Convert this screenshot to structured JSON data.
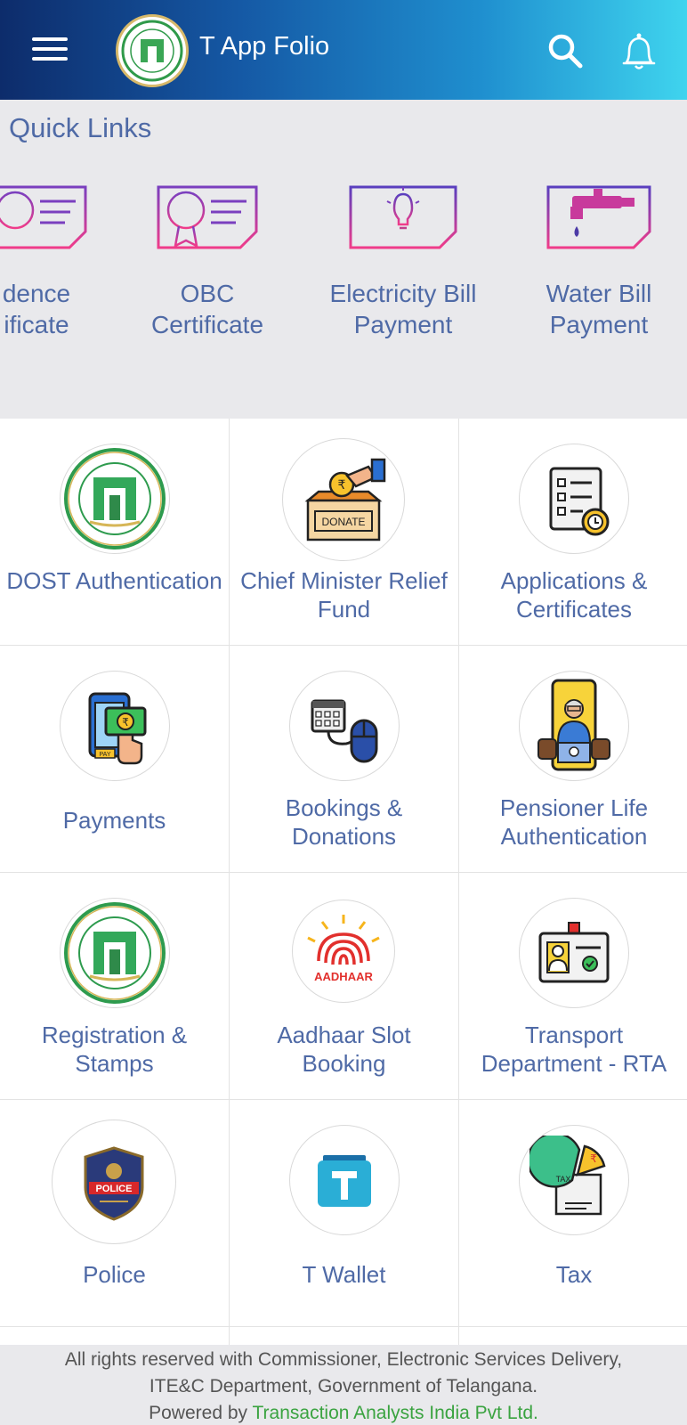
{
  "header": {
    "title": "T App Folio"
  },
  "quick_links": {
    "title": "Quick Links",
    "items": [
      {
        "label": "Residence Certificate",
        "display": "dence\nificate",
        "icon": "certificate-icon"
      },
      {
        "label": "OBC Certificate",
        "display": "OBC\nCertificate",
        "icon": "obc-certificate-icon"
      },
      {
        "label": "Electricity Bill Payment",
        "display": "Electricity Bill\nPayment",
        "icon": "lightbulb-icon"
      },
      {
        "label": "Water Bill Payment",
        "display": "Water Bill\nPayment",
        "icon": "water-tap-icon"
      }
    ]
  },
  "services": [
    {
      "label": "DOST Authentication",
      "icon": "telangana-emblem-icon"
    },
    {
      "label": "Chief Minister Relief Fund",
      "icon": "donate-box-icon"
    },
    {
      "label": "Applications & Certificates",
      "icon": "document-clock-icon"
    },
    {
      "label": "Payments",
      "icon": "mobile-payment-icon"
    },
    {
      "label": "Bookings & Donations",
      "icon": "calendar-mouse-icon"
    },
    {
      "label": "Pensioner Life Authentication",
      "icon": "pensioner-phone-icon"
    },
    {
      "label": "Registration & Stamps",
      "icon": "telangana-emblem-icon"
    },
    {
      "label": "Aadhaar Slot Booking",
      "icon": "aadhaar-icon"
    },
    {
      "label": "Transport Department - RTA",
      "icon": "id-card-icon"
    },
    {
      "label": "Police",
      "icon": "police-badge-icon"
    },
    {
      "label": "T Wallet",
      "icon": "t-wallet-icon"
    },
    {
      "label": "Tax",
      "icon": "tax-chart-icon"
    }
  ],
  "icon_text": {
    "donate": "DONATE",
    "pay": "PAY",
    "aadhaar": "AADHAAR",
    "police": "POLICE",
    "tax": "TAX",
    "rupee": "₹"
  },
  "footer": {
    "line1": "All rights reserved with Commissioner, Electronic Services Delivery,",
    "line2": "ITE&C Department, Government of Telangana.",
    "powered_prefix": "Powered by ",
    "powered_link": "Transaction Analysts India Pvt Ltd."
  },
  "colors": {
    "accent_text": "#4f6aa6",
    "header_start": "#0d2c6b",
    "header_end": "#3fd4ee",
    "footer_link": "#3aa340"
  }
}
